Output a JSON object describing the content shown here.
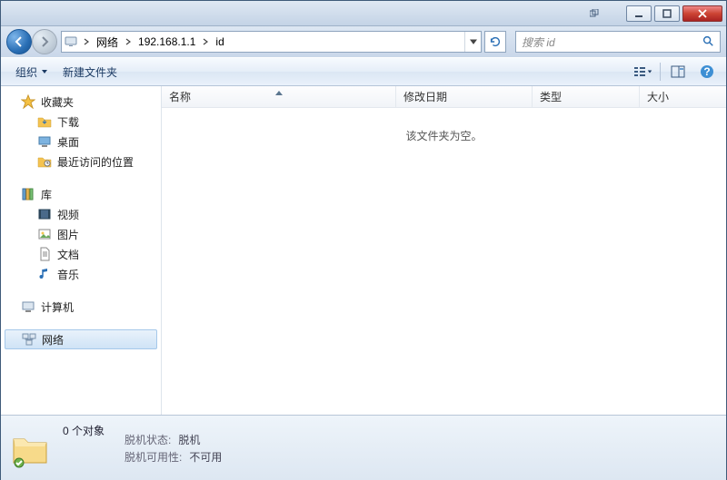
{
  "titlebar": {
    "title": ""
  },
  "nav": {
    "path_segments": [
      "网络",
      "192.168.1.1",
      "id"
    ],
    "search_placeholder": "搜索 id"
  },
  "toolbar": {
    "organize": "组织",
    "new_folder": "新建文件夹"
  },
  "sidebar": {
    "favorites": {
      "label": "收藏夹",
      "items": [
        "下载",
        "桌面",
        "最近访问的位置"
      ]
    },
    "libraries": {
      "label": "库",
      "items": [
        "视频",
        "图片",
        "文档",
        "音乐"
      ]
    },
    "computer": {
      "label": "计算机"
    },
    "network": {
      "label": "网络"
    }
  },
  "columns": {
    "name": "名称",
    "modified": "修改日期",
    "type": "类型",
    "size": "大小"
  },
  "content": {
    "empty_message": "该文件夹为空。"
  },
  "status": {
    "count_label": "0 个对象",
    "offline_state_label": "脱机状态:",
    "offline_state_value": "脱机",
    "offline_avail_label": "脱机可用性:",
    "offline_avail_value": "不可用"
  }
}
